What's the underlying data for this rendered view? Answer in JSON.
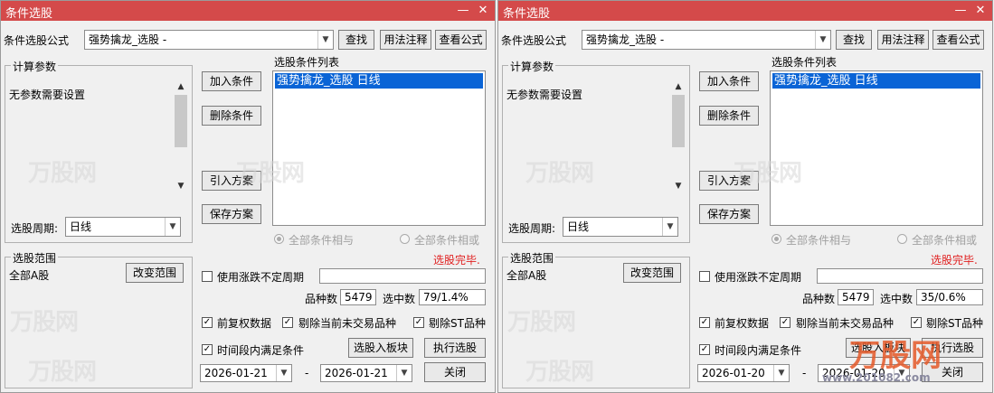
{
  "windows": [
    {
      "title": "条件选股",
      "formula_label": "条件选股公式",
      "formula_value": "强势擒龙_选股  -",
      "find_btn": "查找",
      "usage_btn": "用法注释",
      "view_formula_btn": "查看公式",
      "params_group": "计算参数",
      "params_text": "无参数需要设置",
      "period_label": "选股周期:",
      "period_value": "日线",
      "add_btn": "加入条件",
      "delete_btn": "删除条件",
      "import_btn": "引入方案",
      "save_btn": "保存方案",
      "cond_list_label": "选股条件列表",
      "cond_item": "强势擒龙_选股  日线",
      "radio_and": "全部条件相与",
      "radio_or": "全部条件相或",
      "status": "选股完毕.",
      "range_group": "选股范围",
      "range_value": "全部A股",
      "change_range_btn": "改变范围",
      "use_period_label": "使用涨跌不定周期",
      "count_label": "品种数",
      "count_value": "5479",
      "selected_label": "选中数",
      "selected_value": "79/1.4%",
      "cb_adjust": "前复权数据",
      "cb_exclude_untraded": "剔除当前未交易品种",
      "cb_exclude_st": "剔除ST品种",
      "cb_time_range": "时间段内满足条件",
      "to_block_btn": "选股入板块",
      "run_btn": "执行选股",
      "date_from": "2026-01-21",
      "date_sep": "-",
      "date_to": "2026-01-21",
      "close_btn": "关闭"
    },
    {
      "title": "条件选股",
      "formula_label": "条件选股公式",
      "formula_value": "强势擒龙_选股  -",
      "find_btn": "查找",
      "usage_btn": "用法注释",
      "view_formula_btn": "查看公式",
      "params_group": "计算参数",
      "params_text": "无参数需要设置",
      "period_label": "选股周期:",
      "period_value": "日线",
      "add_btn": "加入条件",
      "delete_btn": "删除条件",
      "import_btn": "引入方案",
      "save_btn": "保存方案",
      "cond_list_label": "选股条件列表",
      "cond_item": "强势擒龙_选股  日线",
      "radio_and": "全部条件相与",
      "radio_or": "全部条件相或",
      "status": "选股完毕.",
      "range_group": "选股范围",
      "range_value": "全部A股",
      "change_range_btn": "改变范围",
      "use_period_label": "使用涨跌不定周期",
      "count_label": "品种数",
      "count_value": "5479",
      "selected_label": "选中数",
      "selected_value": "35/0.6%",
      "cb_adjust": "前复权数据",
      "cb_exclude_untraded": "剔除当前未交易品种",
      "cb_exclude_st": "剔除ST品种",
      "cb_time_range": "时间段内满足条件",
      "to_block_btn": "选股入板块",
      "run_btn": "执行选股",
      "date_from": "2026-01-20",
      "date_sep": "-",
      "date_to": "2026-01-20",
      "close_btn": "关闭"
    }
  ],
  "watermark": {
    "text": "万股网",
    "logo_text": "万股网",
    "url": "www.201082.com"
  },
  "icons": {
    "minimize": "minimize-icon",
    "close": "close-icon",
    "dropdown": "chevron-down-icon",
    "scroll_up": "chevron-up-icon",
    "scroll_down": "chevron-down-icon",
    "check": "check-icon"
  },
  "colors": {
    "titlebar": "#d44a4a",
    "selection": "#0a64d6",
    "status": "#e02020"
  }
}
